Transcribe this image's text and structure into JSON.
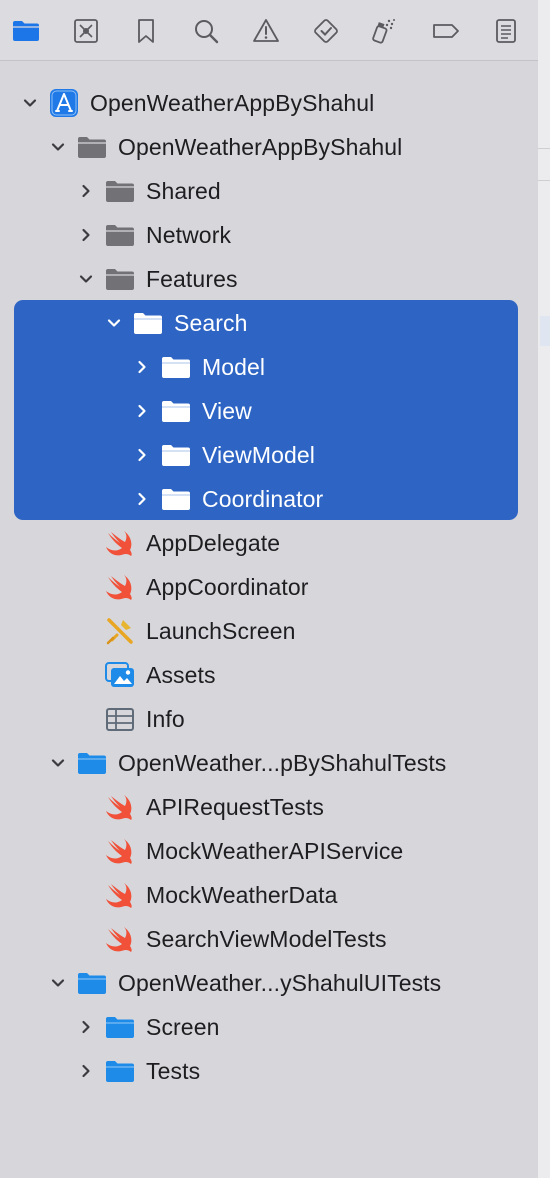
{
  "toolbar": {
    "icons": [
      "folder-icon",
      "source-control-icon",
      "bookmark-icon",
      "search-icon",
      "warning-icon",
      "test-icon",
      "debug-icon",
      "breakpoint-icon",
      "report-icon"
    ],
    "active": "folder-icon",
    "accent": "#1d76e8"
  },
  "colors": {
    "selection": "#2e65c4",
    "folder_gray": "#727276",
    "folder_blue": "#1e8be8",
    "swift_orange": "#f05138"
  },
  "tree": [
    {
      "label": "OpenWeatherAppByShahul",
      "level": 0,
      "chevron": "down",
      "icon": "app-icon"
    },
    {
      "label": "OpenWeatherAppByShahul",
      "level": 1,
      "chevron": "down",
      "icon": "folder-gray-icon"
    },
    {
      "label": "Shared",
      "level": 2,
      "chevron": "right",
      "icon": "folder-gray-icon"
    },
    {
      "label": "Network",
      "level": 2,
      "chevron": "right",
      "icon": "folder-gray-icon"
    },
    {
      "label": "Features",
      "level": 2,
      "chevron": "down",
      "icon": "folder-gray-icon"
    },
    {
      "label": "Search",
      "level": 3,
      "chevron": "down",
      "icon": "folder-white-icon",
      "selected": true
    },
    {
      "label": "Model",
      "level": 4,
      "chevron": "right",
      "icon": "folder-white-icon",
      "selected": true
    },
    {
      "label": "View",
      "level": 4,
      "chevron": "right",
      "icon": "folder-white-icon",
      "selected": true
    },
    {
      "label": "ViewModel",
      "level": 4,
      "chevron": "right",
      "icon": "folder-white-icon",
      "selected": true
    },
    {
      "label": "Coordinator",
      "level": 4,
      "chevron": "right",
      "icon": "folder-white-icon",
      "selected": true
    },
    {
      "label": "AppDelegate",
      "level": 2,
      "chevron": "none",
      "icon": "swift-icon"
    },
    {
      "label": "AppCoordinator",
      "level": 2,
      "chevron": "none",
      "icon": "swift-icon"
    },
    {
      "label": "LaunchScreen",
      "level": 2,
      "chevron": "none",
      "icon": "storyboard-icon"
    },
    {
      "label": "Assets",
      "level": 2,
      "chevron": "none",
      "icon": "assets-icon"
    },
    {
      "label": "Info",
      "level": 2,
      "chevron": "none",
      "icon": "plist-icon"
    },
    {
      "label": "OpenWeather...pByShahulTests",
      "level": 1,
      "chevron": "down",
      "icon": "folder-blue-icon"
    },
    {
      "label": "APIRequestTests",
      "level": 2,
      "chevron": "none",
      "icon": "swift-icon"
    },
    {
      "label": "MockWeatherAPIService",
      "level": 2,
      "chevron": "none",
      "icon": "swift-icon"
    },
    {
      "label": "MockWeatherData",
      "level": 2,
      "chevron": "none",
      "icon": "swift-icon"
    },
    {
      "label": "SearchViewModelTests",
      "level": 2,
      "chevron": "none",
      "icon": "swift-icon"
    },
    {
      "label": "OpenWeather...yShahulUITests",
      "level": 1,
      "chevron": "down",
      "icon": "folder-blue-icon"
    },
    {
      "label": "Screen",
      "level": 2,
      "chevron": "right",
      "icon": "folder-blue-icon"
    },
    {
      "label": "Tests",
      "level": 2,
      "chevron": "right",
      "icon": "folder-blue-icon"
    }
  ]
}
